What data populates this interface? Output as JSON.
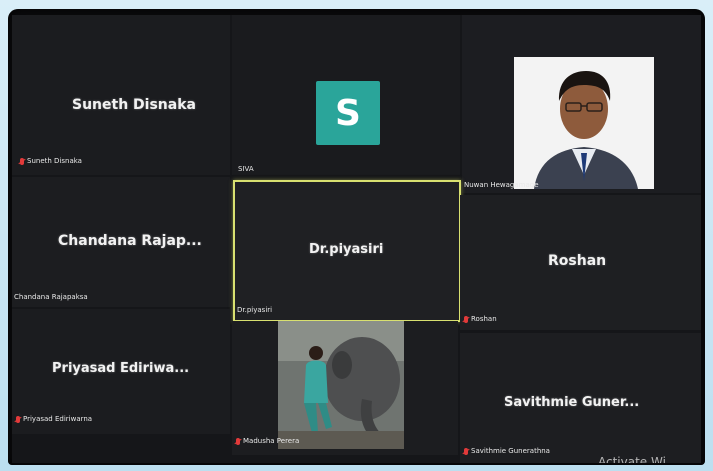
{
  "meeting": {
    "participants": [
      {
        "display_name": "Suneth Disnaka",
        "label": "Suneth Disnaka",
        "muted": true
      },
      {
        "display_name": "",
        "label": "SIVA",
        "avatar_letter": "S",
        "avatar_color": "#2aa59a",
        "muted": false
      },
      {
        "display_name": "",
        "label": "Nuwan Hewagamage",
        "has_video": true,
        "muted": false
      },
      {
        "display_name": "Chandana Rajap...",
        "label": "Chandana Rajapaksa",
        "muted": false
      },
      {
        "display_name": "Dr.piyasiri",
        "label": "Dr.piyasiri",
        "active_speaker": true,
        "muted": false
      },
      {
        "display_name": "Roshan",
        "label": "Roshan",
        "muted": true
      },
      {
        "display_name": "Priyasad Ediriwa...",
        "label": "Priyasad Ediriwarna",
        "muted": true
      },
      {
        "display_name": "",
        "label": "Madusha Perera",
        "has_video": true,
        "muted": true
      },
      {
        "display_name": "Savithmie Guner...",
        "label": "Savithmie Gunerathna",
        "muted": true
      }
    ],
    "active_speaker_color": "#d8e070",
    "mic_muted_color": "#e23a3a"
  },
  "os": {
    "watermark": "Activate Wi"
  }
}
